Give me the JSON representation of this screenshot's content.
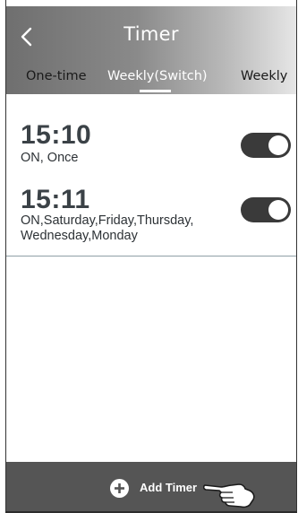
{
  "header": {
    "title": "Timer",
    "back_icon": "chevron-left-icon"
  },
  "tabs": [
    {
      "label": "One-time",
      "selected": false
    },
    {
      "label": "Weekly(Switch)",
      "selected": true
    },
    {
      "label": "Weekly",
      "selected": false
    }
  ],
  "timers": [
    {
      "time": "15:10",
      "description": "ON, Once",
      "enabled": true
    },
    {
      "time": "15:11",
      "description_line1": "ON,Saturday,Friday,Thursday,",
      "description_line2": "Wednesday,Monday",
      "enabled": true
    }
  ],
  "footer": {
    "add_label": "Add Timer",
    "add_icon": "plus-circle-icon",
    "pointer_icon": "hand-pointer-icon"
  },
  "colors": {
    "header_start": "#6f6f6f",
    "header_end": "#e6e6e6",
    "toggle_on": "#3a3a3a",
    "footer_bg": "#555555"
  }
}
